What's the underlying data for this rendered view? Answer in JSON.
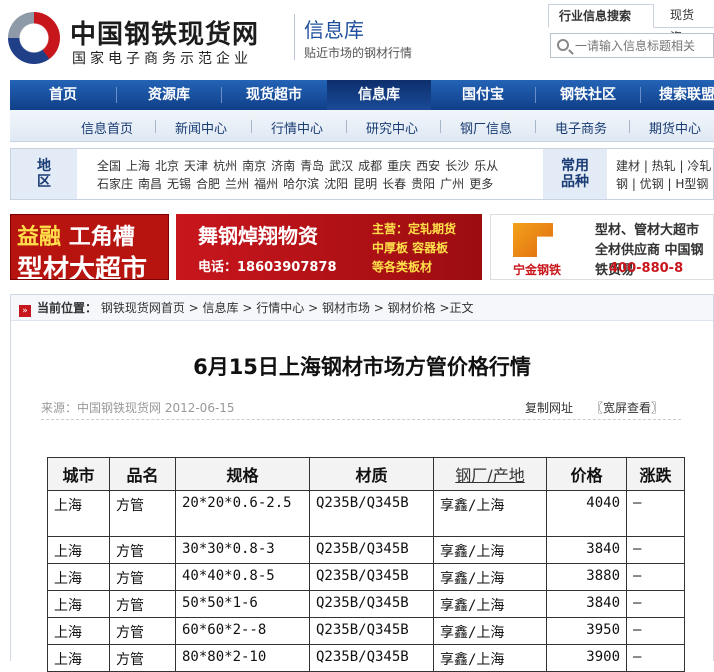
{
  "header": {
    "logo_title": "中国钢铁现货网",
    "logo_subtitle": "国家电子商务示范企业",
    "section_title": "信息库",
    "section_subtitle": "贴近市场的钢材行情",
    "search_tabs": [
      "行业信息搜索",
      "现货资"
    ],
    "search_placeholder": "一请输入信息标题相关"
  },
  "nav": [
    "首页",
    "资源库",
    "现货超市",
    "信息库",
    "国付宝",
    "钢铁社区",
    "搜索联盟"
  ],
  "subnav": [
    "信息首页",
    "新闻中心",
    "行情中心",
    "研究中心",
    "钢厂信息",
    "电子商务",
    "期货中心"
  ],
  "region": {
    "label": "地区",
    "cities_row1": [
      "全国",
      "上海",
      "北京",
      "天津",
      "杭州",
      "南京",
      "济南",
      "青岛",
      "武汉",
      "成都",
      "重庆",
      "西安",
      "长沙",
      "乐从"
    ],
    "cities_row2": [
      "石家庄",
      "南昌",
      "无锡",
      "合肥",
      "兰州",
      "福州",
      "哈尔滨",
      "沈阳",
      "昆明",
      "长春",
      "贵阳",
      "广州",
      "更多"
    ],
    "products_label": "常用品种",
    "products_row1": "建材 | 热轧 | 冷轧",
    "products_row2": "钢 | 优钢 | H型钢"
  },
  "ads": {
    "ad1_line1a": "益融",
    "ad1_line1b": "工角槽",
    "ad1_line2": "型材大超市",
    "ad2_title": "舞钢焯翔物资",
    "ad2_tel": "电话：18603907878",
    "ad2_lines": [
      "主营：定轧期货",
      "中厚板 容器板",
      "等各类板材"
    ],
    "ad3_name": "宁金钢铁",
    "ad3_desc": "型材、管材大超市 全材供应商 中国钢铁贸易",
    "ad3_phone": "400-880-8"
  },
  "breadcrumb": {
    "prefix": "当前位置：",
    "items": [
      "钢铁现货网首页",
      "信息库",
      "行情中心",
      "钢材市场",
      "钢材价格"
    ],
    "current": "正文"
  },
  "article": {
    "title": "6月15日上海钢材市场方管价格行情",
    "source": "来源：中国钢铁现货网 2012-06-15",
    "copy_link": "复制网址",
    "wide_view": "〖宽屏查看〗"
  },
  "table": {
    "headers": [
      "城市",
      "品名",
      "规格",
      "材质",
      "钢厂/产地",
      "价格",
      "涨跌"
    ],
    "rows": [
      [
        "上海",
        "方管",
        "20*20*0.6-2.5",
        "Q235B/Q345B",
        "享鑫/上海",
        "4040",
        "—"
      ],
      [
        "上海",
        "方管",
        "30*30*0.8-3",
        "Q235B/Q345B",
        "享鑫/上海",
        "3840",
        "—"
      ],
      [
        "上海",
        "方管",
        "40*40*0.8-5",
        "Q235B/Q345B",
        "享鑫/上海",
        "3880",
        "—"
      ],
      [
        "上海",
        "方管",
        "50*50*1-6",
        "Q235B/Q345B",
        "享鑫/上海",
        "3840",
        "—"
      ],
      [
        "上海",
        "方管",
        "60*60*2--8",
        "Q235B/Q345B",
        "享鑫/上海",
        "3950",
        "—"
      ],
      [
        "上海",
        "方管",
        "80*80*2-10",
        "Q235B/Q345B",
        "享鑫/上海",
        "3900",
        "—"
      ]
    ]
  }
}
